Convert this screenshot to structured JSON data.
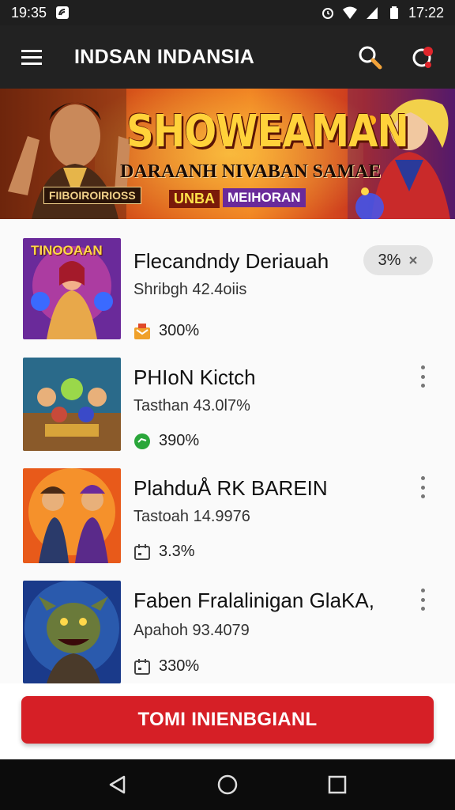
{
  "status_bar": {
    "time_left": "19:35",
    "time_right": "17:22"
  },
  "app_bar": {
    "title": "INDSAN INDANSIA"
  },
  "banner": {
    "title": "SHOWEAMAN",
    "subtitle": "DARAANH NIVABAN SAMAE",
    "tag1": "UNBA",
    "tag2": "MEIHORAN",
    "plate": "FIIBOIROIRIOSS"
  },
  "items": [
    {
      "title": "Flecandndy Deriauah",
      "subtitle": "Shribgh 42.4oiis",
      "stat": "300%",
      "stat_icon": "gift-icon",
      "pill": "3%",
      "thumb_label": "TINOOAAN"
    },
    {
      "title": "PHIoN Kictch",
      "subtitle": "Tasthan 43.0l7%",
      "stat": "390%",
      "stat_icon": "chat-bubble-icon"
    },
    {
      "title": "PlahduÅ RK BAREIN",
      "subtitle": "Tastoah 14.9976",
      "stat": "3.3%",
      "stat_icon": "calendar-icon"
    },
    {
      "title": "Faben Fralalinigan GlaKA,",
      "subtitle": "Apahoh 93.4079",
      "stat": "330%",
      "stat_icon": "calendar-icon"
    }
  ],
  "cta": {
    "label": "TOMI INIENBGIANL"
  },
  "colors": {
    "accent": "#d61f26",
    "app_bar": "#222222",
    "status_bar": "#1f1f1f"
  }
}
